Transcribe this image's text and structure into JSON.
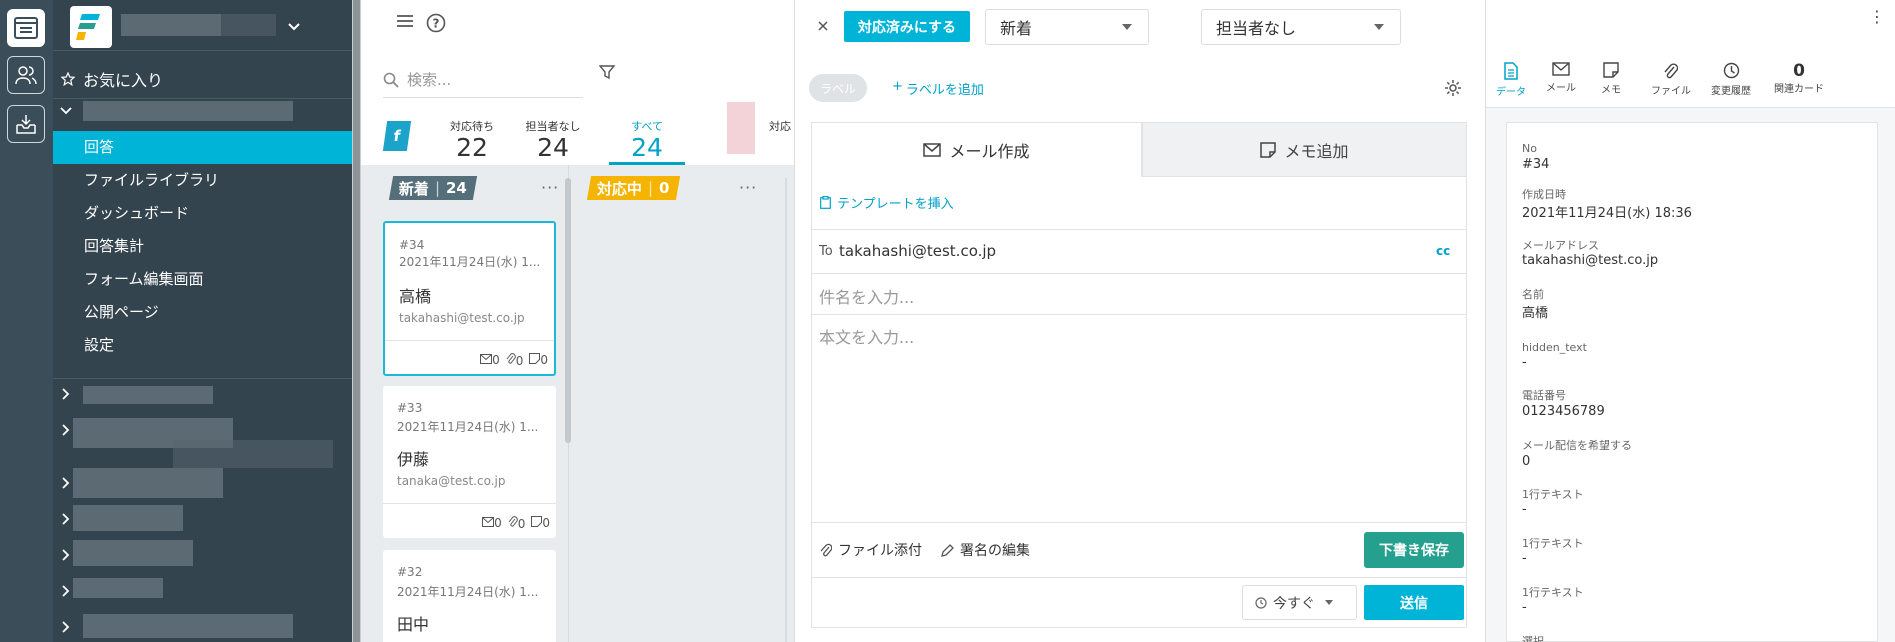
{
  "nav": {
    "favorites": "お気に入り",
    "menu": [
      "回答",
      "ファイルライブラリ",
      "ダッシュボード",
      "回答集計",
      "フォーム編集画面",
      "公開ページ",
      "設定"
    ]
  },
  "board": {
    "search_placeholder": "検索...",
    "tabs": [
      {
        "label": "対応待ち",
        "count": "22"
      },
      {
        "label": "担当者なし",
        "count": "24"
      },
      {
        "label": "すべて",
        "count": "24"
      },
      {
        "label": "対応",
        "count": ""
      }
    ],
    "brand_letter": "f",
    "columns": [
      {
        "title": "新着",
        "count": "24",
        "color": "#546e7a"
      },
      {
        "title": "対応中",
        "count": "0",
        "color": "#f4b400"
      }
    ],
    "cards": [
      {
        "no": "#34",
        "date": "2021年11月24日(水) 1...",
        "name": "高橋",
        "email": "takahashi@test.co.jp",
        "mail": "0",
        "file": "0",
        "memo": "0"
      },
      {
        "no": "#33",
        "date": "2021年11月24日(水) 1...",
        "name": "伊藤",
        "email": "tanaka@test.co.jp",
        "mail": "0",
        "file": "0",
        "memo": "0"
      },
      {
        "no": "#32",
        "date": "2021年11月24日(水) 1...",
        "name": "田中",
        "email": "",
        "mail": "",
        "file": "",
        "memo": ""
      }
    ]
  },
  "main": {
    "resolve_button": "対応済みにする",
    "status_select": "新着",
    "assignee_select": "担当者なし",
    "label_chip": "ラベル",
    "add_label": "ラベルを追加",
    "tab_email": "メール作成",
    "tab_memo": "メモ追加",
    "insert_template": "テンプレートを挿入",
    "to_label": "To",
    "to_value": "takahashi@test.co.jp",
    "cc_label": "cc",
    "subject_placeholder": "件名を入力...",
    "body_placeholder": "本文を入力...",
    "attach_label": "ファイル添付",
    "signature_label": "署名の編集",
    "draft_button": "下書き保存",
    "schedule_select": "今すぐ",
    "send_button": "送信"
  },
  "rpanel": {
    "tabs": [
      {
        "label": "データ",
        "icon": "document-icon"
      },
      {
        "label": "メール",
        "icon": "mail-icon"
      },
      {
        "label": "メモ",
        "icon": "memo-icon"
      },
      {
        "label": "ファイル",
        "icon": "paperclip-icon"
      },
      {
        "label": "変更履歴",
        "icon": "clock-icon"
      },
      {
        "label": "関連カード",
        "count": "0"
      }
    ],
    "fields": [
      {
        "label": "No",
        "value": "#34"
      },
      {
        "label": "作成日時",
        "value": "2021年11月24日(水) 18:36"
      },
      {
        "label": "メールアドレス",
        "value": "takahashi@test.co.jp"
      },
      {
        "label": "名前",
        "value": "高橋"
      },
      {
        "label": "hidden_text",
        "value": "-"
      },
      {
        "label": "電話番号",
        "value": "0123456789"
      },
      {
        "label": "メール配信を希望する",
        "value": "0"
      },
      {
        "label": "1行テキスト",
        "value": "-"
      },
      {
        "label": "1行テキスト",
        "value": "-"
      },
      {
        "label": "1行テキスト",
        "value": "-"
      },
      {
        "label": "選択",
        "value": ""
      }
    ]
  },
  "colors": {
    "accent": "#00b4d8",
    "sidebar": "#34444f",
    "rail": "#3b4d58",
    "green": "#26a08e"
  }
}
